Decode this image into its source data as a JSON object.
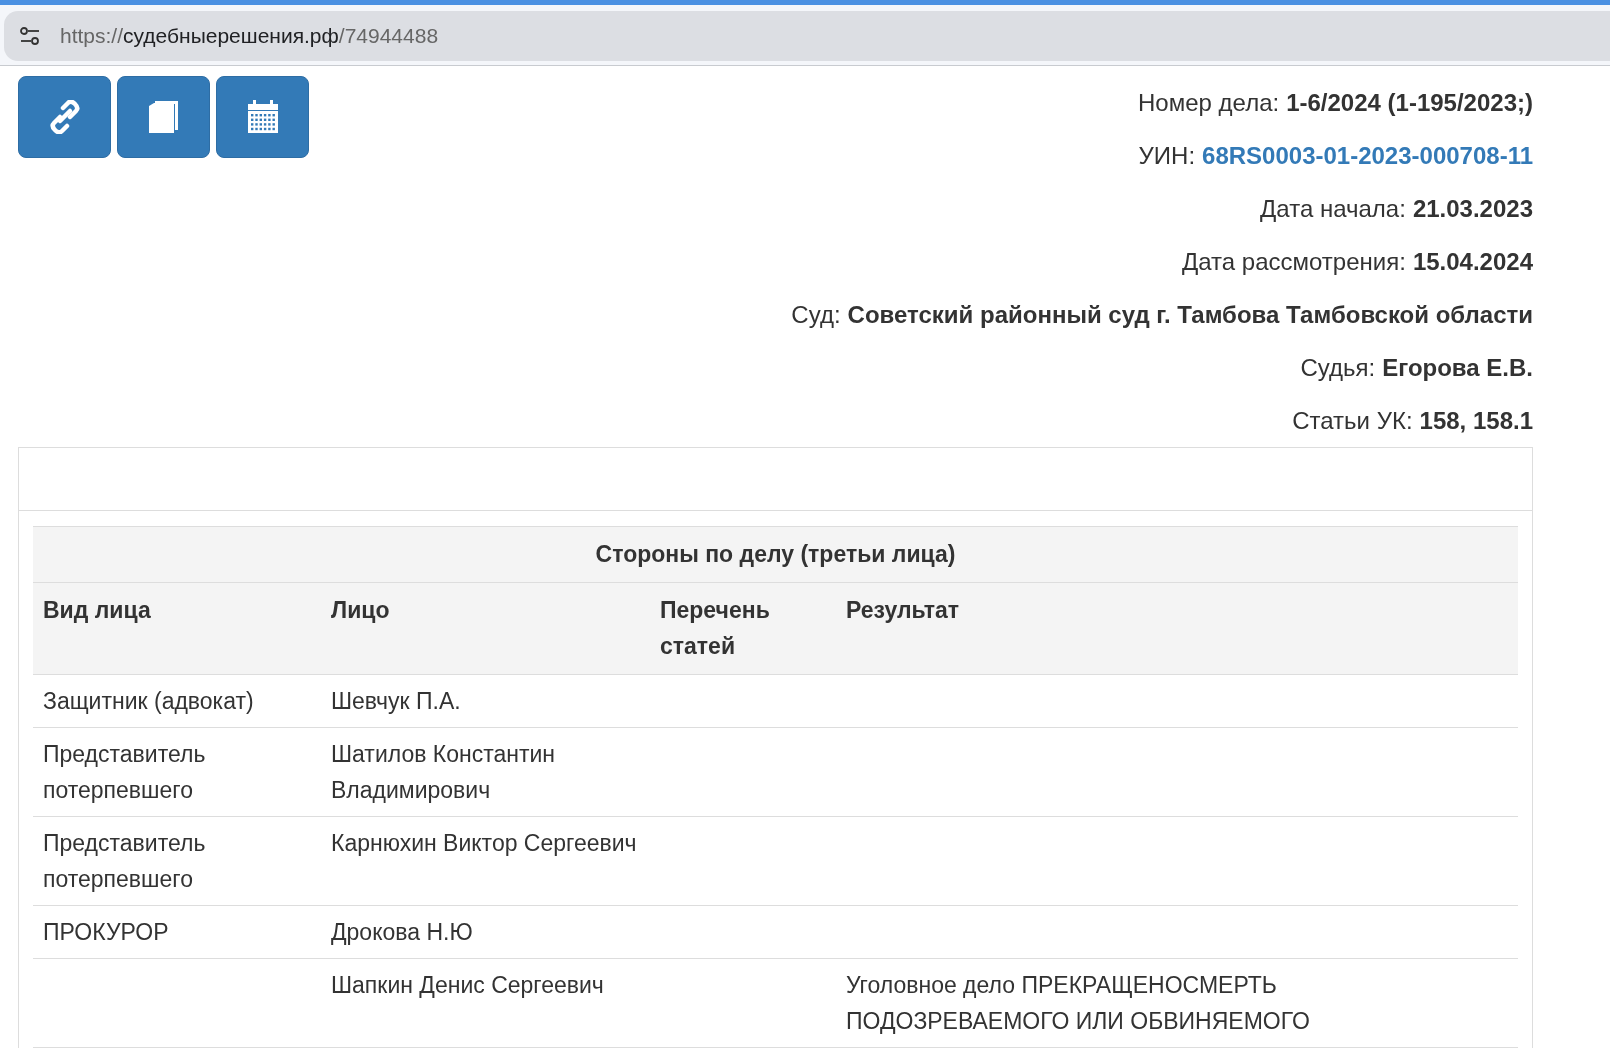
{
  "browser": {
    "url_scheme": "https://",
    "url_host": "судебныерешения.рф",
    "url_path": "/74944488"
  },
  "toolbar": [
    {
      "kind": "link"
    },
    {
      "kind": "copy"
    },
    {
      "kind": "calendar"
    }
  ],
  "case_info": [
    {
      "label": "Номер дела:",
      "value": "1-6/2024 (1-195/2023;)",
      "kind": "text"
    },
    {
      "label": "УИН:",
      "value": "68RS0003-01-2023-000708-11",
      "kind": "link"
    },
    {
      "label": "Дата начала:",
      "value": "21.03.2023",
      "kind": "text"
    },
    {
      "label": "Дата рассмотрения:",
      "value": "15.04.2024",
      "kind": "text"
    },
    {
      "label": "Суд:",
      "value": "Советский районный суд г. Тамбова Тамбовской области",
      "kind": "text"
    },
    {
      "label": "Судья:",
      "value": "Егорова Е.В.",
      "kind": "text"
    },
    {
      "label": "Статьи УК:",
      "value": "158, 158.1",
      "kind": "text"
    }
  ],
  "table": {
    "title": "Стороны по делу (третьи лица)",
    "columns": [
      "Вид лица",
      "Лицо",
      "Перечень статей",
      "Результат"
    ],
    "rows": [
      [
        "Защитник (адвокат)",
        "Шевчук П.А.",
        "",
        ""
      ],
      [
        "Представитель потерпевшего",
        "Шатилов Константин Владимирович",
        "",
        ""
      ],
      [
        "Представитель потерпевшего",
        "Карнюхин Виктор Сергеевич",
        "",
        ""
      ],
      [
        "ПРОКУРОР",
        "Дрокова Н.Ю",
        "",
        ""
      ],
      [
        "",
        "Шапкин Денис Сергеевич",
        "",
        "Уголовное дело ПРЕКРАЩЕНОСМЕРТЬ ПОДОЗРЕВАЕМОГО ИЛИ ОБВИНЯЕМОГО"
      ]
    ]
  }
}
